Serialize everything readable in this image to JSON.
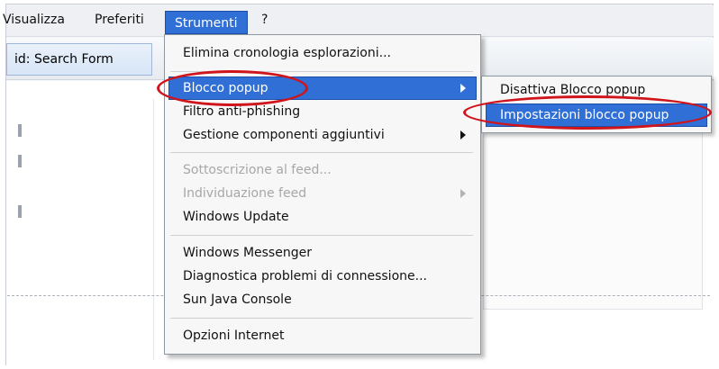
{
  "menubar": {
    "items": [
      {
        "label": "Visualizza"
      },
      {
        "label": "Preferiti"
      },
      {
        "label": "Strumenti"
      },
      {
        "label": "?"
      }
    ]
  },
  "toolbar": {
    "tab_label": "id: Search Form"
  },
  "dropdown": {
    "items": [
      {
        "label": "Elimina cronologia esplorazioni..."
      },
      {
        "label": "Blocco popup"
      },
      {
        "label": "Filtro anti-phishing"
      },
      {
        "label": "Gestione componenti aggiuntivi"
      },
      {
        "label": "Sottoscrizione al feed..."
      },
      {
        "label": "Individuazione feed"
      },
      {
        "label": "Windows Update"
      },
      {
        "label": "Windows Messenger"
      },
      {
        "label": "Diagnostica problemi di connessione..."
      },
      {
        "label": "Sun Java Console"
      },
      {
        "label": "Opzioni Internet"
      }
    ]
  },
  "submenu": {
    "items": [
      {
        "label": "Disattiva Blocco popup"
      },
      {
        "label": "Impostazioni blocco popup"
      }
    ]
  },
  "colors": {
    "highlight": "#2f6fd6",
    "annotation": "#d0141c"
  }
}
